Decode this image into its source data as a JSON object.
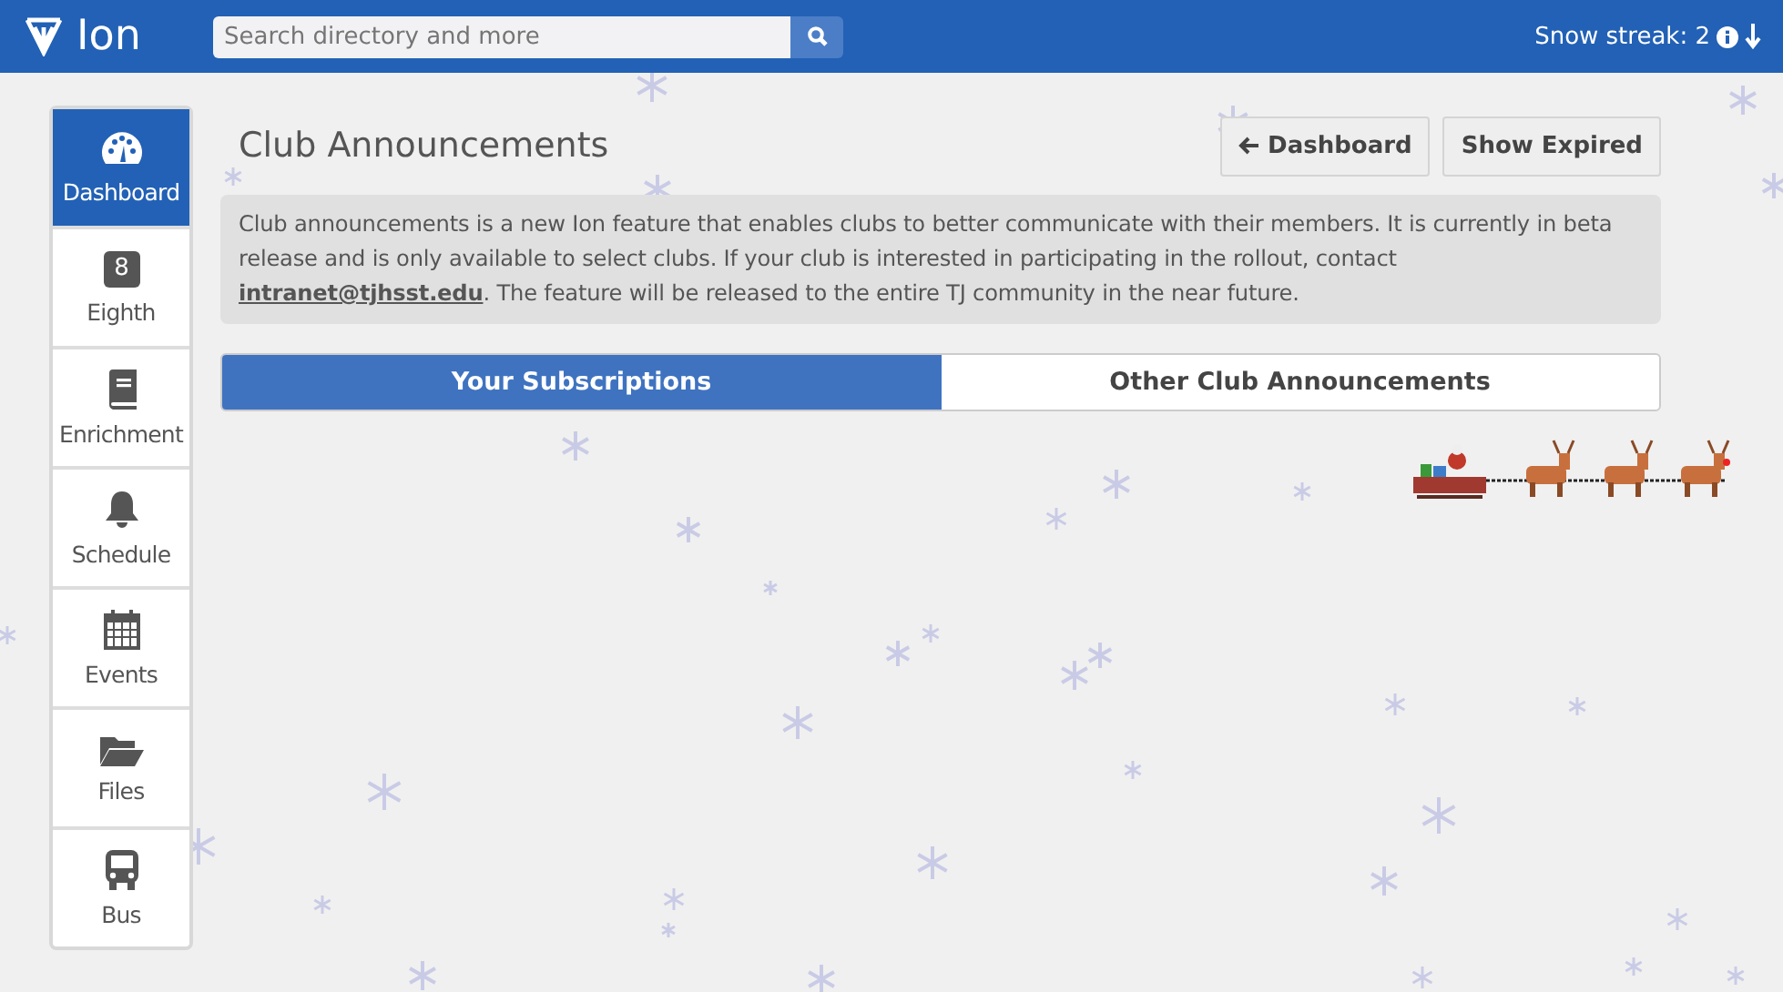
{
  "header": {
    "logo": "Ion",
    "search": {
      "placeholder": "Search directory and more"
    },
    "streak": "Snow streak: 2"
  },
  "sidebar": {
    "items": [
      {
        "label": "Dashboard",
        "kind": "dashboard",
        "selected": true
      },
      {
        "label": "Eighth",
        "kind": "eighth",
        "badge": "8",
        "selected": false
      },
      {
        "label": "Enrichment",
        "kind": "book",
        "selected": false
      },
      {
        "label": "Schedule",
        "kind": "bell",
        "selected": false
      },
      {
        "label": "Events",
        "kind": "calendar",
        "selected": false
      },
      {
        "label": "Files",
        "kind": "folder",
        "selected": false
      },
      {
        "label": "Bus",
        "kind": "bus",
        "selected": false
      }
    ]
  },
  "page": {
    "title": "Club Announcements",
    "buttons": [
      {
        "label": "Dashboard",
        "kind": "back"
      },
      {
        "label": "Show Expired",
        "kind": "plain"
      }
    ],
    "notice": "Club announcements is a new Ion feature that enables clubs to better communicate with their members. It is currently in beta release and is only available to select clubs. If your club is interested in participating in the rollout, contact **intranet@tjhsst.edu**. The feature will be released to the entire TJ community in the near future.",
    "tabs": [
      {
        "label": "Your Subscriptions",
        "selected": true
      },
      {
        "label": "Other Club Announcements",
        "selected": false
      }
    ]
  }
}
